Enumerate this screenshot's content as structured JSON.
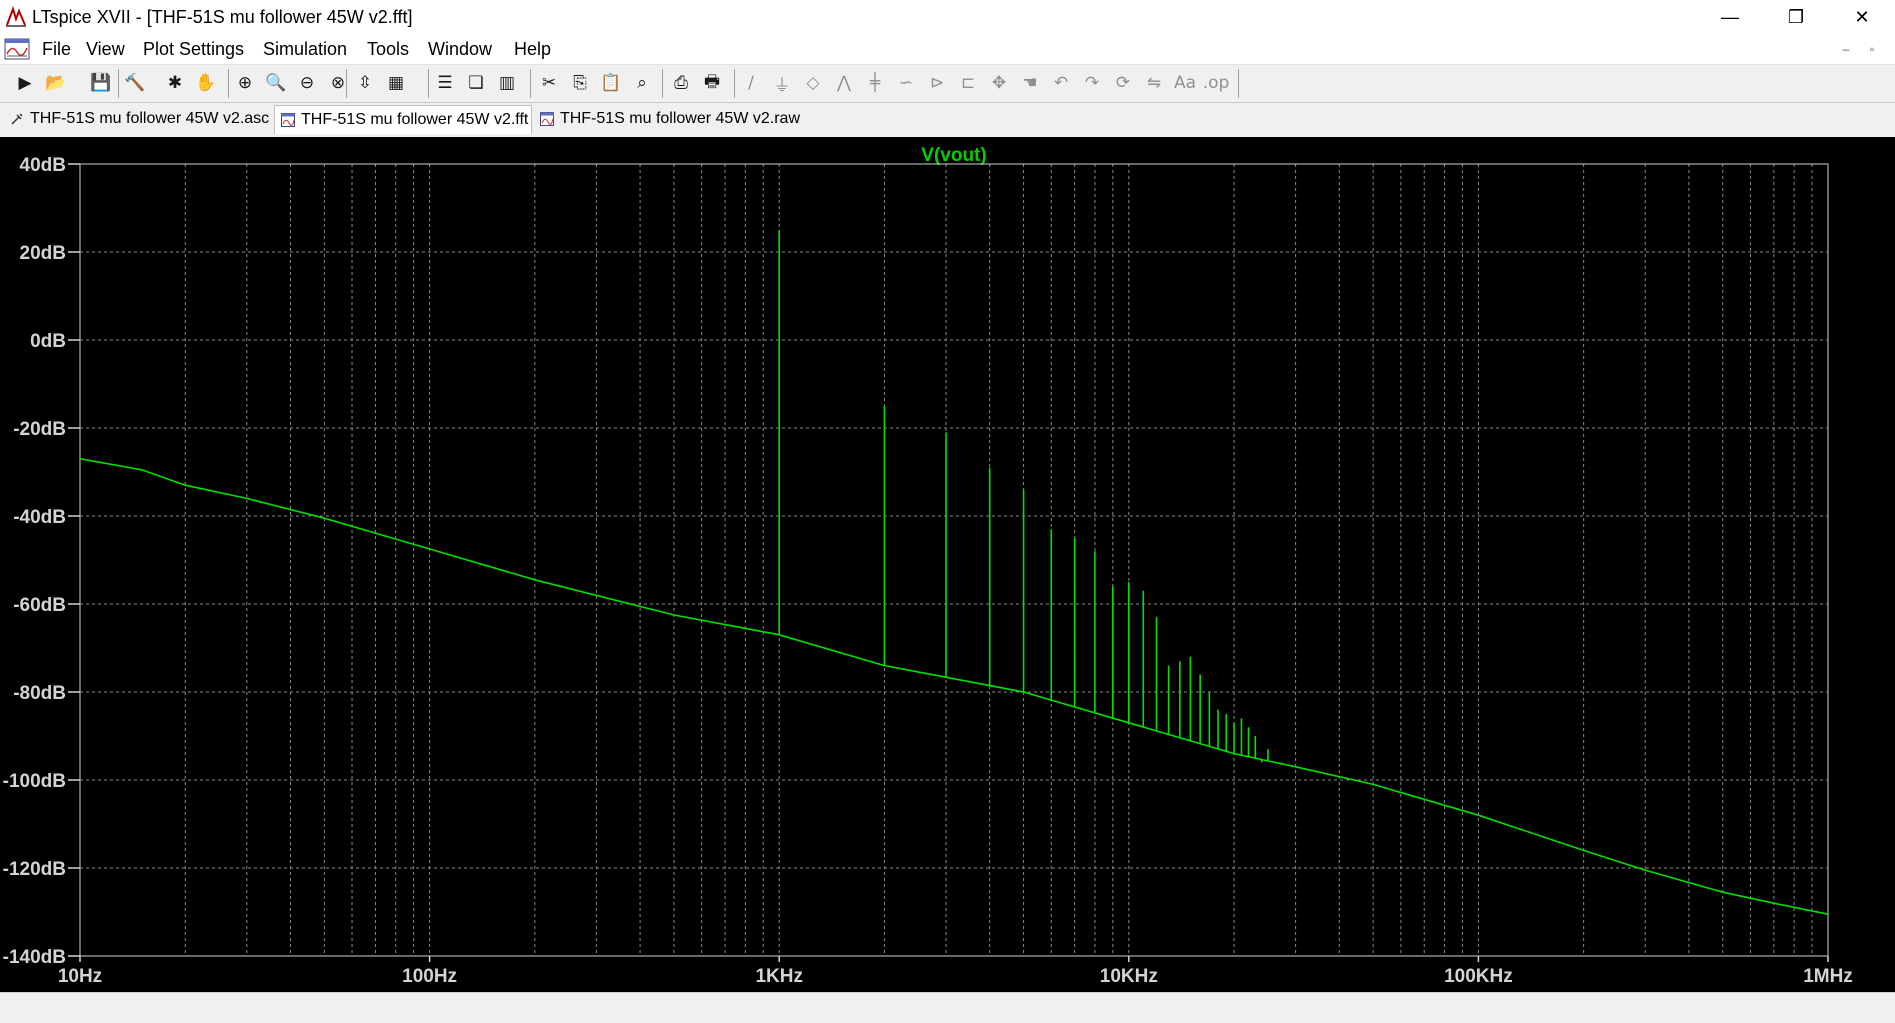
{
  "window": {
    "title": "LTspice XVII - [THF-51S mu follower 45W v2.fft]",
    "controls": {
      "minimize": "—",
      "restore": "❐",
      "close": "✕"
    }
  },
  "menu": {
    "items": [
      "File",
      "View",
      "Plot Settings",
      "Simulation",
      "Tools",
      "Window",
      "Help"
    ],
    "mdi_controls": {
      "minimize": "–",
      "restore": "▫"
    }
  },
  "toolbar": {
    "buttons": [
      "run-icon",
      "open-icon",
      "save-icon",
      "control-panel-icon",
      "halt-icon",
      "pan-icon",
      "zoom-in-icon",
      "zoom-area-icon",
      "zoom-out-icon",
      "zoom-full-icon",
      "autorange-icon",
      "grid-icon",
      "tile-horizontal-icon",
      "cascade-icon",
      "tile-vertical-icon",
      "cut-icon",
      "copy-icon",
      "paste-icon",
      "find-icon",
      "print-icon",
      "print-setup-icon",
      "wire-icon",
      "ground-icon",
      "label-icon",
      "resistor-icon",
      "capacitor-icon",
      "inductor-icon",
      "diode-icon",
      "component-icon",
      "move-icon",
      "drag-icon",
      "undo-icon",
      "redo-icon",
      "rotate-icon",
      "mirror-icon",
      "text-icon",
      "spice-directive-icon"
    ]
  },
  "tabs": [
    {
      "label": "THF-51S mu follower 45W v2.asc",
      "active": false,
      "icon": "schematic-icon"
    },
    {
      "label": "THF-51S mu follower 45W v2.fft",
      "active": true,
      "icon": "waveform-icon"
    },
    {
      "label": "THF-51S mu follower 45W v2.raw",
      "active": false,
      "icon": "waveform-icon"
    }
  ],
  "colors": {
    "trace": "#00e000",
    "trace_label": "#00d000",
    "plot_background": "#000000",
    "axis_text": "#d4d4d4",
    "grid": "#8a8a8a"
  },
  "chart_data": {
    "type": "line",
    "title": "V(vout)",
    "xscale": "log",
    "xlim": [
      10,
      1000000
    ],
    "ylim": [
      -140,
      40
    ],
    "grid": true,
    "x_ticks": [
      "10Hz",
      "100Hz",
      "1KHz",
      "10KHz",
      "100KHz",
      "1MHz"
    ],
    "y_ticks": [
      "40dB",
      "20dB",
      "0dB",
      "-20dB",
      "-40dB",
      "-60dB",
      "-80dB",
      "-100dB",
      "-120dB",
      "-140dB"
    ],
    "series": [
      {
        "name": "V(vout)",
        "floor": {
          "x": [
            10,
            15,
            20,
            30,
            50,
            100,
            200,
            500,
            1000,
            2000,
            5000,
            10000,
            20000,
            30000,
            50000,
            100000,
            200000,
            300000,
            500000,
            700000,
            1000000
          ],
          "y": [
            -27,
            -29.5,
            -33,
            -36,
            -40.5,
            -47.5,
            -54.5,
            -62.5,
            -67,
            -74,
            -80,
            -87,
            -94,
            -97,
            -101,
            -108,
            -116,
            -120.5,
            -125.5,
            -128,
            -130.5
          ]
        },
        "peaks": {
          "x": [
            1000,
            2000,
            3000,
            4000,
            5000,
            6000,
            7000,
            8000,
            9000,
            10000,
            11000,
            12000,
            13000,
            14000,
            15000,
            16000,
            17000,
            18000,
            19000,
            20000,
            21000,
            22000,
            23000,
            24000,
            25000
          ],
          "y": [
            25,
            -15,
            -21,
            -29,
            -34,
            -43,
            -45,
            -48,
            -56,
            -55,
            -57,
            -63,
            -74,
            -73,
            -72,
            -76,
            -80,
            -84,
            -85,
            -87,
            -86,
            -88,
            -90,
            -96,
            -93
          ]
        }
      }
    ]
  },
  "status": {
    "text": ""
  }
}
